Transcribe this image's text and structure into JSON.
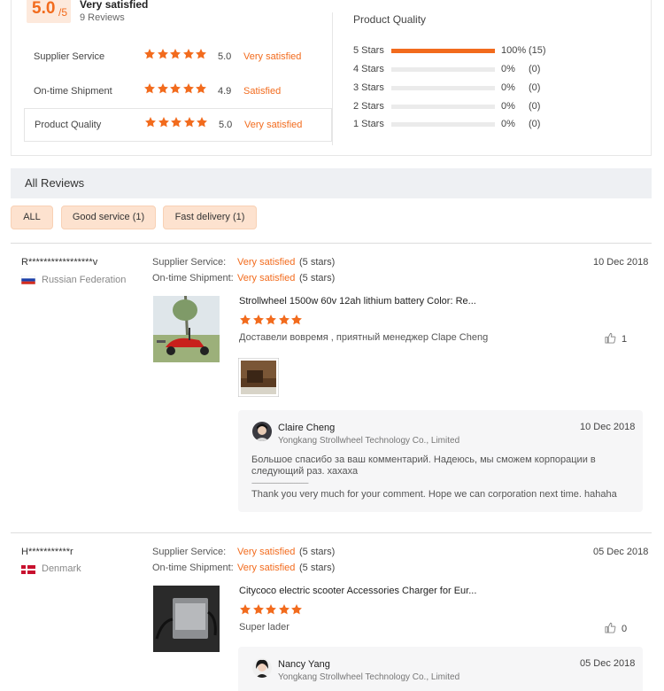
{
  "summary": {
    "score": "5.0",
    "score_den": "/5",
    "overall_label": "Very satisfied",
    "review_count": "9 Reviews",
    "ratings": [
      {
        "label": "Supplier Service",
        "score": "5.0",
        "text": "Very satisfied",
        "stars": 5
      },
      {
        "label": "On-time Shipment",
        "score": "4.9",
        "text": "Satisfied",
        "stars": 5
      },
      {
        "label": "Product Quality",
        "score": "5.0",
        "text": "Very satisfied",
        "stars": 5
      }
    ],
    "quality_title": "Product Quality",
    "distribution": [
      {
        "label": "5 Stars",
        "pct": "100%",
        "count": "(15)",
        "fill": 1.0
      },
      {
        "label": "4 Stars",
        "pct": "0%",
        "count": "(0)",
        "fill": 0
      },
      {
        "label": "3 Stars",
        "pct": "0%",
        "count": "(0)",
        "fill": 0
      },
      {
        "label": "2 Stars",
        "pct": "0%",
        "count": "(0)",
        "fill": 0
      },
      {
        "label": "1 Stars",
        "pct": "0%",
        "count": "(0)",
        "fill": 0
      }
    ]
  },
  "all_reviews": {
    "title": "All Reviews",
    "filters": [
      "ALL",
      "Good service (1)",
      "Fast delivery (1)"
    ]
  },
  "labels": {
    "supplier_service": "Supplier Service:",
    "ontime_shipment": "On-time Shipment:"
  },
  "reviews": [
    {
      "reviewer": "R*****************v",
      "country": "Russian Federation",
      "supplier_text": "Very satisfied",
      "supplier_stars": "(5 stars)",
      "shipment_text": "Very satisfied",
      "shipment_stars": "(5 stars)",
      "date": "10 Dec 2018",
      "product_title": "Strollwheel 1500w 60v 12ah lithium battery Color: Re...",
      "stars": 5,
      "comment": "Доставели вовремя , приятный менеджер Clape Cheng",
      "likes": "1",
      "reply": {
        "name": "Claire Cheng",
        "company": "Yongkang Strollwheel Technology Co., Limited",
        "date": "10 Dec 2018",
        "text_ru": "Большое спасибо за ваш комментарий. Надеюсь, мы сможем корпорации в следующий раз. хахаха",
        "separator": "--------------------------------",
        "text_en": "Thank you very much for your comment. Hope we can corporation next time. hahaha"
      }
    },
    {
      "reviewer": "H***********r",
      "country": "Denmark",
      "supplier_text": "Very satisfied",
      "supplier_stars": "(5 stars)",
      "shipment_text": "Very satisfied",
      "shipment_stars": "(5 stars)",
      "date": "05 Dec 2018",
      "product_title": "Citycoco electric scooter Accessories Charger for Eur...",
      "stars": 5,
      "comment": "Super lader",
      "likes": "0",
      "reply": {
        "name": "Nancy Yang",
        "company": "Yongkang Strollwheel Technology Co., Limited",
        "date": "05 Dec 2018"
      }
    }
  ],
  "colors": {
    "accent": "#f26b1d",
    "accent_bg": "#fde9dc",
    "panel": "#eef0f3"
  }
}
